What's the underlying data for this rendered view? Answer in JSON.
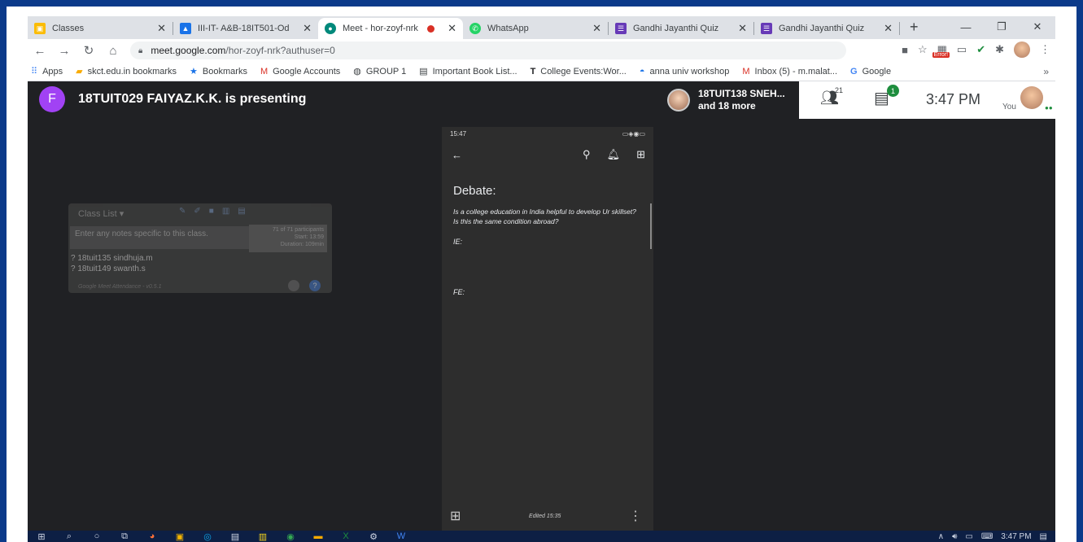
{
  "browser": {
    "tabs": [
      {
        "label": "Classes",
        "icon_color": "#fbbc04"
      },
      {
        "label": "III-IT- A&B-18IT501-Od",
        "icon_color": "#1a73e8"
      },
      {
        "label": "Meet - hor-zoyf-nrk",
        "icon_color": "#00897b",
        "active": true
      },
      {
        "label": "WhatsApp",
        "icon_color": "#25d366"
      },
      {
        "label": "Gandhi Jayanthi Quiz",
        "icon_color": "#673ab7"
      },
      {
        "label": "Gandhi Jayanthi Quiz",
        "icon_color": "#673ab7"
      }
    ],
    "url_host": "meet.google.com",
    "url_path": "/hor-zoyf-nrk?authuser=0",
    "error_badge": "Error!",
    "bookmarks": [
      {
        "label": "Apps",
        "icon": "apps-grid-icon"
      },
      {
        "label": "skct.edu.in bookmarks",
        "icon": "folder-icon"
      },
      {
        "label": "Bookmarks",
        "icon": "star-icon"
      },
      {
        "label": "Google Accounts",
        "icon": "gmail-icon"
      },
      {
        "label": "GROUP 1",
        "icon": "globe-icon"
      },
      {
        "label": "Important Book List...",
        "icon": "book-icon"
      },
      {
        "label": "College Events:Wor...",
        "icon": "t-icon"
      },
      {
        "label": "anna univ workshop",
        "icon": "user-icon"
      },
      {
        "label": "Inbox (5) - m.malat...",
        "icon": "gmail-icon"
      },
      {
        "label": "Google",
        "icon": "google-icon"
      }
    ]
  },
  "meet": {
    "presenter_initial": "F",
    "presenter_text": "18TUIT029 FAIYAZ.K.K. is presenting",
    "participant_chip_line1": "18TUIT138 SNEH...",
    "participant_chip_line2": "and 18 more",
    "people_count": "21",
    "chat_badge": "1",
    "clock": "3:47 PM",
    "you_label": "You"
  },
  "phone": {
    "status_time": "15:47",
    "title": "Debate:",
    "body": "Is a college education in India helpful to develop Ur skillset? Is this the same condition abroad?",
    "ie_label": "IE:",
    "fe_label": "FE:",
    "edited": "Edited 15:35"
  },
  "class_list": {
    "header": "Class List",
    "notes_placeholder": "Enter any notes specific to this class.",
    "stats_line1": "71 of 71 participants",
    "stats_line2": "Start: 13:59",
    "stats_line3": "Duration: 109min",
    "items": [
      "? 18tuit135 sindhuja.m",
      "? 18tuit149 swanth.s"
    ],
    "footer": "Google Meet Attendance - v0.5.1"
  },
  "taskbar": {
    "time": "3:47 PM"
  }
}
